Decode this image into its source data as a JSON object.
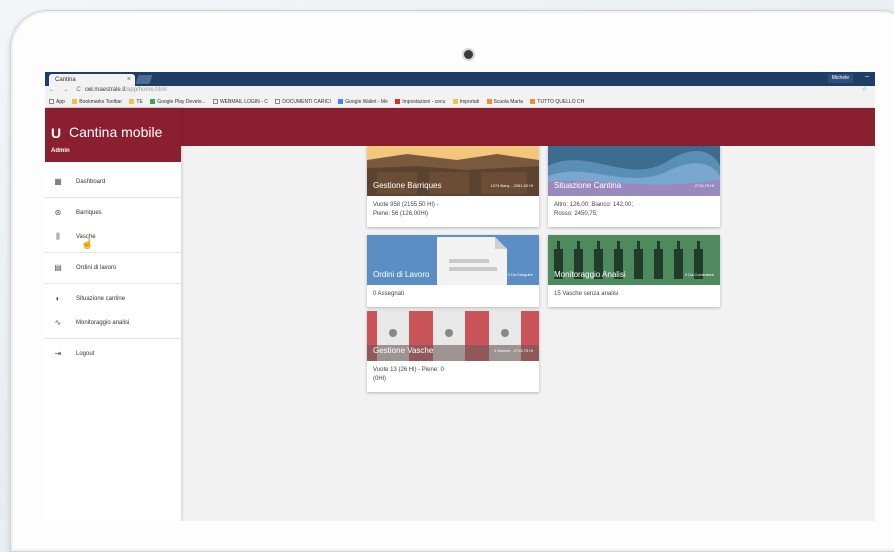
{
  "browser": {
    "tab_title": "Cantina",
    "tab_close": "×",
    "user": "Michele",
    "window_controls": "–",
    "url_host": "cel.maestrale.it",
    "url_path": "/app/home.html",
    "nav_icons": "← → C ⌂",
    "bookmarks": [
      "App",
      "Bookmarks Toolbar",
      "TE",
      "Google Play Develo...",
      "WEBMAIL LOGIN - C",
      "DOCUMENTI CARICI",
      "Google Wallet - Me",
      "Impostazioni - cecu",
      "Importati",
      "Scuola Marta",
      "TUTTO QUELLO CH"
    ],
    "star": "☆"
  },
  "app": {
    "logo": "U",
    "title": "Cantina mobile",
    "role": "Admin",
    "accent": "#8a1f30"
  },
  "menu": [
    {
      "icon": "dashboard-icon",
      "glyph": "▦",
      "label": "Dashboard"
    },
    {
      "icon": "barrel-icon",
      "glyph": "⊛",
      "label": "Barriques"
    },
    {
      "icon": "tanks-icon",
      "glyph": "⫼",
      "label": "Vasche"
    },
    {
      "icon": "document-icon",
      "glyph": "▤",
      "label": "Ordini di lavoro"
    },
    {
      "icon": "pie-icon",
      "glyph": "◐",
      "label": "Situazione cantine"
    },
    {
      "icon": "trend-icon",
      "glyph": "∿",
      "label": "Monitoraggio analisi"
    },
    {
      "icon": "logout-icon",
      "glyph": "⇥",
      "label": "Logout"
    }
  ],
  "cards": [
    {
      "title": "Gestione Barriques",
      "badge": "1074 Barq. - 2281,50 Hl",
      "lines": [
        "Vuote 958 (2155,50 Hl) -",
        "Piene: 56 (126,00Hl)"
      ]
    },
    {
      "title": "Situazione Cantina",
      "badge": "2716,75 Hl",
      "lines": [
        "Altro: 126,00; Bianco: 142,00;",
        "Rosso: 2450,75;"
      ]
    },
    {
      "title": "Ordini di Lavoro",
      "badge": "0 Da Eseguire",
      "lines": [
        "0 Assegnati"
      ]
    },
    {
      "title": "Monitoraggio Analisi",
      "badge": "0 Da Controllare",
      "lines": [
        "15 Vasche senza analisi"
      ]
    },
    {
      "title": "Gestione Vasche",
      "badge": "3 Vasche - 2716,75 Hl",
      "lines": [
        "Vuote 13 (26 Hl) - Piene: 0",
        "(0Hl)"
      ]
    }
  ]
}
